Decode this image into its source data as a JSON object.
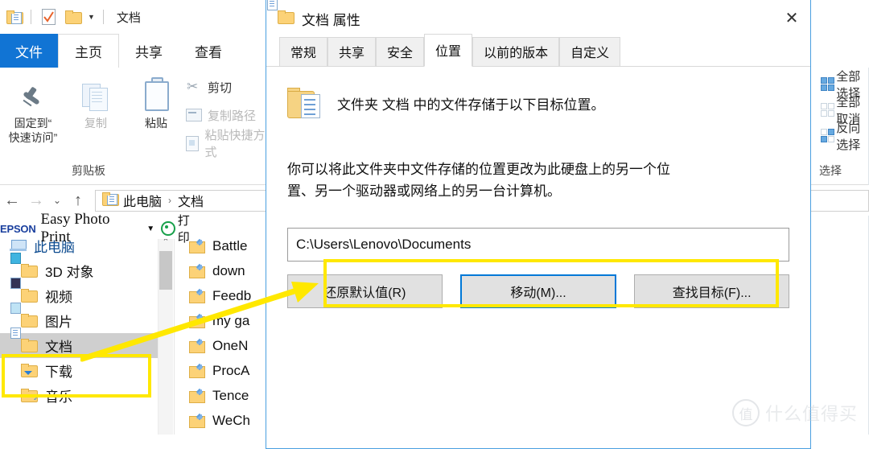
{
  "explorer": {
    "quick_access": {
      "title": "文档",
      "icons": [
        "folder-document-icon",
        "checkmark-document-icon",
        "folder-icon",
        "chevron-down-icon"
      ]
    },
    "ribbon_tabs": [
      {
        "label": "文件",
        "state": "file-menu"
      },
      {
        "label": "主页",
        "state": "active"
      },
      {
        "label": "共享",
        "state": "normal"
      },
      {
        "label": "查看",
        "state": "normal"
      }
    ],
    "clipboard_group": {
      "group_label": "剪贴板",
      "pin": {
        "line1": "固定到“",
        "line2": "快速访问”"
      },
      "copy": "复制",
      "paste": "粘贴",
      "cut": "剪切",
      "copy_path": "复制路径",
      "paste_shortcut": "粘贴快捷方式"
    },
    "select_group": {
      "group_label": "选择",
      "items": [
        "全部选择",
        "全部取消",
        "反向选择"
      ]
    },
    "address_bar": {
      "back": "←",
      "forward": "→",
      "recent": "⌄",
      "up": "↑",
      "breadcrumb": [
        "此电脑",
        "文档"
      ],
      "separator": "›"
    },
    "epson_toolbar": {
      "brand": "EPSON",
      "name": "Easy Photo Print",
      "caret": "▼",
      "print_label": "打印"
    },
    "nav_pane": {
      "root": "此电脑",
      "items": [
        {
          "label": "3D 对象",
          "icon": "folder-3d-icon",
          "selected": false
        },
        {
          "label": "视频",
          "icon": "folder-video-icon",
          "selected": false
        },
        {
          "label": "图片",
          "icon": "folder-pictures-icon",
          "selected": false
        },
        {
          "label": "文档",
          "icon": "folder-documents-icon",
          "selected": true
        },
        {
          "label": "下载",
          "icon": "folder-downloads-icon",
          "selected": false
        },
        {
          "label": "音乐",
          "icon": "folder-music-icon",
          "selected": false
        }
      ]
    },
    "file_list": [
      {
        "name": "Battle"
      },
      {
        "name": "down"
      },
      {
        "name": "Feedb"
      },
      {
        "name": "my ga"
      },
      {
        "name": "OneN"
      },
      {
        "name": "ProcA"
      },
      {
        "name": "Tence"
      },
      {
        "name": "WeCh"
      }
    ]
  },
  "dialog": {
    "title": "文档 属性",
    "close": "✕",
    "tabs": [
      {
        "label": "常规",
        "active": false
      },
      {
        "label": "共享",
        "active": false
      },
      {
        "label": "安全",
        "active": false
      },
      {
        "label": "位置",
        "active": true
      },
      {
        "label": "以前的版本",
        "active": false
      },
      {
        "label": "自定义",
        "active": false
      }
    ],
    "header_text": "文件夹 文档 中的文件存储于以下目标位置。",
    "description_line1": "你可以将此文件夹中文件存储的位置更改为此硬盘上的另一个位",
    "description_line2": "置、另一个驱动器或网络上的另一台计算机。",
    "path_value": "C:\\Users\\Lenovo\\Documents",
    "buttons": [
      {
        "label": "还原默认值(R)",
        "focused": false
      },
      {
        "label": "移动(M)...",
        "focused": true
      },
      {
        "label": "查找目标(F)...",
        "focused": false
      }
    ]
  },
  "annotations": {
    "highlight_color": "#ffe800",
    "path_highlight": "path-field-highlight",
    "sidebar_highlight": "documents-folder-highlight",
    "arrow": "yellow-arrow-pointer"
  },
  "watermark": {
    "mark": "值",
    "text": "什么值得买"
  }
}
